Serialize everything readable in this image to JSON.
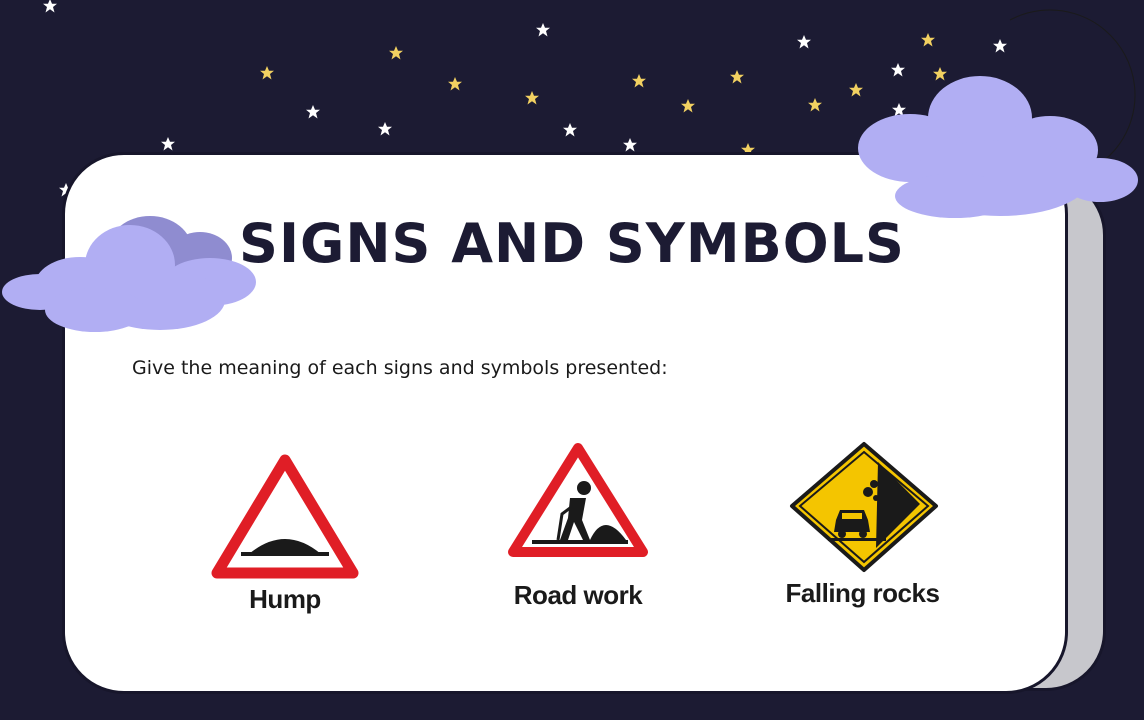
{
  "slide": {
    "title": "SIGNS AND SYMBOLS",
    "instruction": "Give the meaning of each signs and symbols presented:"
  },
  "signs": [
    {
      "label": "Hump",
      "icon": "hump-warning-sign"
    },
    {
      "label": "Road work",
      "icon": "road-work-warning-sign"
    },
    {
      "label": "Falling rocks",
      "icon": "falling-rocks-warning-sign"
    }
  ],
  "colors": {
    "background": "#1c1b33",
    "card": "#ffffff",
    "cloud": "#b1aef3",
    "moon": "#f2d161",
    "sign_red": "#e01e26",
    "sign_yellow": "#f4c500"
  }
}
